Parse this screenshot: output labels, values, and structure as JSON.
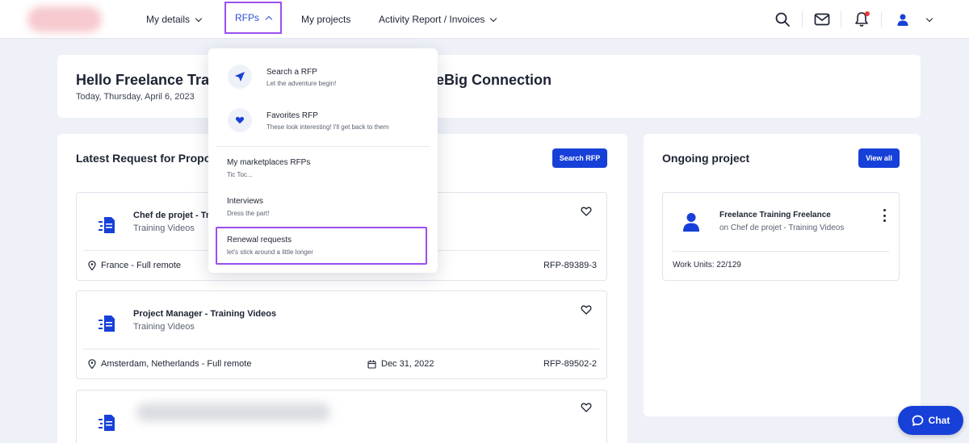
{
  "nav": {
    "my_details": "My details",
    "rfps": "RFPs",
    "my_projects": "My projects",
    "activity_report": "Activity Report / Invoices"
  },
  "header_icons": [
    "search-icon",
    "mail-icon",
    "bell-icon",
    "user-icon"
  ],
  "welcome": {
    "title_start": "Hello Freelance Tra",
    "title_end": "eBig Connection",
    "date": "Today, Thursday, April 6, 2023"
  },
  "latest": {
    "title": "Latest Request for Propo",
    "search_button": "Search RFP",
    "items": [
      {
        "title": "Chef de projet - Tr",
        "subtitle": "Training Videos",
        "location": "France - Full remote",
        "date": "",
        "reference": "RFP-89389-3"
      },
      {
        "title": "Project Manager - Training Videos",
        "subtitle": "Training Videos",
        "location": "Amsterdam, Netherlands - Full remote",
        "date": "Dec 31, 2022",
        "reference": "RFP-89502-2"
      }
    ]
  },
  "ongoing": {
    "title": "Ongoing project",
    "view_all": "View all",
    "project": {
      "title": "Freelance Training Freelance",
      "subtitle": "on Chef de projet - Training Videos",
      "work_units": "Work Units: 22/129"
    }
  },
  "dropdown": {
    "items": [
      {
        "title": "Search a RFP",
        "subtitle": "Let the adventure begin!"
      },
      {
        "title": "Favorites RFP",
        "subtitle": "These look interesting! I'll get back to them"
      },
      {
        "title": "My marketplaces RFPs",
        "subtitle": "Tic Toc..."
      },
      {
        "title": "Interviews",
        "subtitle": "Dress the part!"
      },
      {
        "title": "Renewal requests",
        "subtitle": "let's stick around a little longer"
      }
    ]
  },
  "chat": {
    "label": "Chat"
  },
  "colors": {
    "primary": "#1740d8",
    "highlight": "#9b4ef0",
    "background": "#eef1f7",
    "notification": "#e53935"
  }
}
